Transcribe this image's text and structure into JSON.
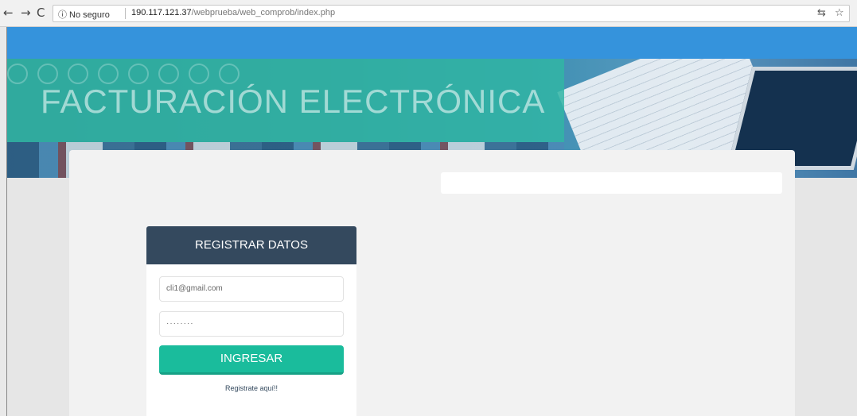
{
  "browser": {
    "back_icon": "back-arrow-icon",
    "forward_icon": "forward-arrow-icon",
    "reload_icon": "reload-icon",
    "security_text": "ⓘ No seguro",
    "url_host": "190.117.121.37",
    "url_path": "/webprueba/web_comprob/index.php",
    "translate_icon": "translate-icon",
    "bookmark_icon": "star-icon"
  },
  "hero": {
    "title": "FACTURACIÓN ELECTRÓNICA"
  },
  "login": {
    "header": "REGISTRAR DATOS",
    "email_value": "cli1@gmail.com",
    "password_value": "········",
    "submit_label": "INGRESAR",
    "register_link": "Registrate aquí!!"
  },
  "colors": {
    "topbar": "#3593dc",
    "card_header": "#34495e",
    "button": "#1abc9c"
  }
}
